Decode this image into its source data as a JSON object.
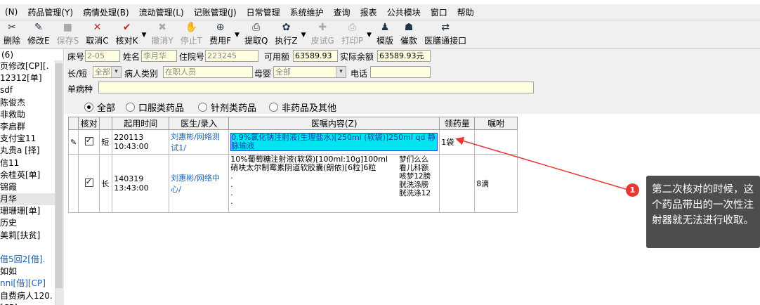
{
  "menu": [
    "(N)",
    "药品管理(Y)",
    "病情处理(B)",
    "流动管理(L)",
    "记账管理(J)",
    "日常管理",
    "系统维护",
    "查询",
    "报表",
    "公共模块",
    "窗口",
    "帮助"
  ],
  "toolbar": [
    {
      "label": "删除",
      "icon": "delete-icon",
      "glyph": "✂",
      "disabled": false
    },
    {
      "label": "修改E",
      "icon": "edit-icon",
      "glyph": "✎",
      "disabled": false
    },
    {
      "label": "保存S",
      "icon": "save-icon",
      "glyph": "■",
      "disabled": true
    },
    {
      "label": "取消C",
      "icon": "cancel-icon",
      "glyph": "✕",
      "disabled": false
    },
    {
      "label": "核对K",
      "icon": "check-icon",
      "glyph": "✔",
      "disabled": false
    },
    {
      "label": "撤消Y",
      "icon": "undo-icon",
      "glyph": "✖",
      "disabled": true
    },
    {
      "label": "停止T",
      "icon": "stop-icon",
      "glyph": "✋",
      "disabled": true
    },
    {
      "label": "费用F",
      "icon": "fee-icon",
      "glyph": "⊕",
      "disabled": false
    },
    {
      "label": "提取Q",
      "icon": "extract-icon",
      "glyph": "⎙",
      "disabled": false
    },
    {
      "label": "执行Z",
      "icon": "execute-icon",
      "glyph": "✿",
      "disabled": false
    },
    {
      "label": "皮试G",
      "icon": "skin-test-icon",
      "glyph": "✚",
      "disabled": true
    },
    {
      "label": "打印P",
      "icon": "print-icon",
      "glyph": "⎙",
      "disabled": true
    },
    {
      "label": "模版",
      "icon": "template-icon",
      "glyph": "♟",
      "disabled": false
    },
    {
      "label": "催款",
      "icon": "remind-pay-icon",
      "glyph": "☗",
      "disabled": false
    },
    {
      "label": "医膳通接口",
      "icon": "interface-icon",
      "glyph": "⇄",
      "disabled": false
    }
  ],
  "left_list": {
    "header": "(6)",
    "items": [
      {
        "text": "页修改[CP][.",
        "style": ""
      },
      {
        "text": " 12312[单]",
        "style": ""
      },
      {
        "text": "sdf",
        "style": ""
      },
      {
        "text": "陈俊杰",
        "style": ""
      },
      {
        "text": "非救助",
        "style": ""
      },
      {
        "text": "李启群",
        "style": ""
      },
      {
        "text": "支付宝11",
        "style": ""
      },
      {
        "text": "丸贵a [择]",
        "style": ""
      },
      {
        "text": "信11",
        "style": ""
      },
      {
        "text": " 余桂英[单]",
        "style": ""
      },
      {
        "text": "锦霞",
        "style": ""
      },
      {
        "text": "月华",
        "style": "sel"
      },
      {
        "text": "珊珊珊[单]",
        "style": ""
      },
      {
        "text": "历史",
        "style": ""
      },
      {
        "text": "美莉[扶贫]",
        "style": ""
      },
      {
        "text": "",
        "style": ""
      },
      {
        "text": "借5回2[借].",
        "style": "blue"
      },
      {
        "text": "如如",
        "style": ""
      },
      {
        "text": "nni[借][CP]",
        "style": "blue"
      },
      {
        "text": "自费病人120.",
        "style": ""
      },
      {
        "text": "  [CP]",
        "style": ""
      }
    ]
  },
  "form": {
    "bed_label": "床号",
    "bed_value": "2-05",
    "name_label": "姓名",
    "name_value": "李月华",
    "admission_label": "住院号",
    "admission_value": "223245",
    "available_label": "可用额",
    "available_value": "63589.93",
    "balance_label": "实际余额",
    "balance_value": "63589.93元",
    "term_label": "长/短",
    "term_value": "全部",
    "type_label": "病人类别",
    "type_value": "在职人员",
    "baby_label": "母婴",
    "baby_value": "全部",
    "phone_label": "电话",
    "phone_value": "",
    "disease_label": "单病种",
    "disease_value": ""
  },
  "filter": {
    "options": [
      {
        "label": "全部",
        "checked": true
      },
      {
        "label": "口服类药品",
        "checked": false
      },
      {
        "label": "针剂类药品",
        "checked": false
      },
      {
        "label": "非药品及其他",
        "checked": false
      }
    ]
  },
  "grid": {
    "headers": [
      "",
      "核对",
      "",
      "起用时间",
      "医生/录入",
      "医嘱内容(Z)",
      "领药量",
      "嘱咐"
    ],
    "rows": [
      {
        "edit": "✎",
        "checked": true,
        "term": "短",
        "time": "220113 10:43:00",
        "doctor": "刘惠彬/网络测试1/",
        "order": "0.9%氯化钠注射液(生理盐水)[250ml (软袋)]250ml qd 静脉输液",
        "dose": "1袋",
        "note": "",
        "highlight": true
      },
      {
        "edit": "",
        "checked": true,
        "term": "长",
        "time": "140319 13:43:00",
        "doctor": "刘惠彬/网络中心/",
        "order_lines": [
          "10%葡萄糖注射液(软袋)[100ml:10g]100ml",
          "硝呋太尔制霉素阴道软胶囊(朗依)[6粒]6粒",
          ".",
          ".",
          ".",
          "."
        ],
        "order_side": "梦们么么看儿科额咳梦12膀胱洗涤膀胱洗涤12",
        "dose": "",
        "note": "8滴",
        "highlight": false
      }
    ]
  },
  "annotation": {
    "number": "1",
    "text": "第二次核对的时候，这个药品带出的一次性注射器就无法进行收取。"
  }
}
